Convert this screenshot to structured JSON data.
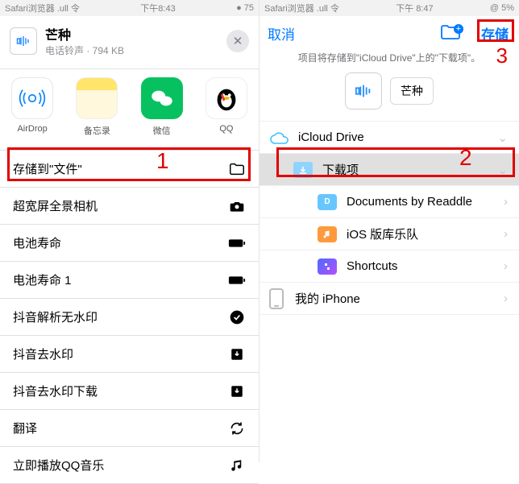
{
  "status_left": {
    "carrier": "Safari浏览器 .ull 令",
    "time": "下午8:43",
    "battery": "● 75"
  },
  "status_right": {
    "carrier": "Safari浏览器 .ull 令",
    "time": "下午 8:47",
    "battery": "@ 5%"
  },
  "file": {
    "title": "芒种",
    "subtitle": "电话铃声 · 794 KB"
  },
  "share": {
    "airdrop": "AirDrop",
    "notes": "备忘录",
    "wechat": "微信",
    "qq": "QQ"
  },
  "actions": {
    "save_files": "存储到\"文件\"",
    "pano": "超宽屏全景相机",
    "battery": "电池寿命",
    "battery1": "电池寿命 1",
    "douyin_nowm": "抖音解析无水印",
    "douyin_rm": "抖音去水印",
    "douyin_dl": "抖音去水印下载",
    "translate": "翻译",
    "qqmusic": "立即播放QQ音乐"
  },
  "nav": {
    "cancel": "取消",
    "save": "存储"
  },
  "dest_note": "项目将存储到\"iCloud Drive\"上的\"下载项\"。",
  "preview_name": "芒种",
  "tree": {
    "icloud": "iCloud Drive",
    "downloads": "下载项",
    "readdle": "Documents by Readdle",
    "garageband": "iOS 版库乐队",
    "shortcuts": "Shortcuts",
    "iphone": "我的 iPhone"
  },
  "annot": {
    "one": "1",
    "two": "2",
    "three": "3"
  }
}
